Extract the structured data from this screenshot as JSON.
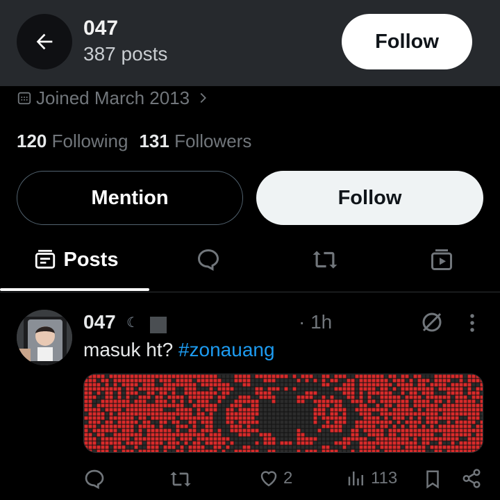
{
  "header": {
    "name": "047",
    "post_count": "387 posts",
    "follow_label": "Follow",
    "back_icon": "arrow-left-icon"
  },
  "profile": {
    "joined": "Joined March 2013",
    "following_count": "120",
    "following_label": "Following",
    "followers_count": "131",
    "followers_label": "Followers",
    "mention_label": "Mention",
    "follow_label": "Follow"
  },
  "tabs": [
    {
      "label": "Posts",
      "icon": "posts-icon",
      "active": true
    },
    {
      "label": "",
      "icon": "reply-bubble-icon",
      "active": false
    },
    {
      "label": "",
      "icon": "retweet-icon",
      "active": false
    },
    {
      "label": "",
      "icon": "media-play-icon",
      "active": false
    }
  ],
  "post": {
    "author": "047",
    "time": "1h",
    "text": "masuk ht?",
    "hashtag": "#zonauang",
    "likes": "2",
    "views": "113"
  },
  "colors": {
    "accent": "#1d9bf0",
    "header_bg": "#26292d",
    "media_red": "#d92a2a",
    "media_dark": "#2b2b2b"
  }
}
